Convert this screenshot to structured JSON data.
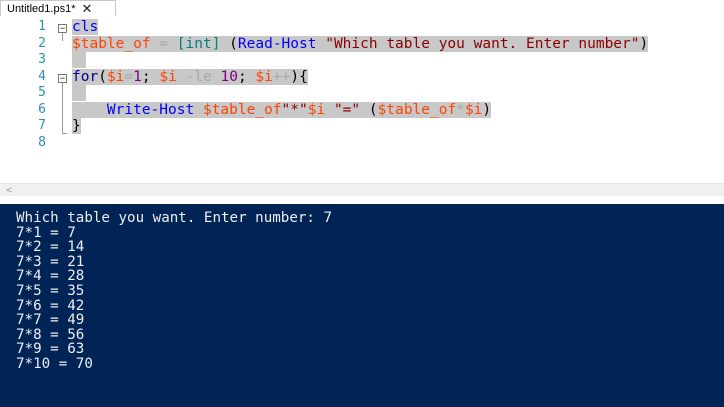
{
  "tab": {
    "title": "Untitled1.ps1*",
    "close_glyph": "✕"
  },
  "editor": {
    "line_numbers": [
      "1",
      "2",
      "3",
      "4",
      "5",
      "6",
      "7",
      "8"
    ],
    "fold_glyph": "−",
    "lines": [
      [
        {
          "t": "cls",
          "c": "t-cmd"
        }
      ],
      [
        {
          "t": "$table_of",
          "c": "t-var"
        },
        {
          "t": " = ",
          "c": "t-op"
        },
        {
          "t": "[int]",
          "c": "t-type"
        },
        {
          "t": " (",
          "c": "t-pl"
        },
        {
          "t": "Read-Host",
          "c": "t-cmd"
        },
        {
          "t": " ",
          "c": "t-pl"
        },
        {
          "t": "\"Which table you want. Enter number\"",
          "c": "t-str"
        },
        {
          "t": ")",
          "c": "t-pl"
        }
      ],
      [],
      [
        {
          "t": "for",
          "c": "t-kw"
        },
        {
          "t": "(",
          "c": "t-pl"
        },
        {
          "t": "$i",
          "c": "t-var"
        },
        {
          "t": "=",
          "c": "t-op"
        },
        {
          "t": "1",
          "c": "t-num"
        },
        {
          "t": "; ",
          "c": "t-pl"
        },
        {
          "t": "$i",
          "c": "t-var"
        },
        {
          "t": " -le ",
          "c": "t-op"
        },
        {
          "t": "10",
          "c": "t-num"
        },
        {
          "t": "; ",
          "c": "t-pl"
        },
        {
          "t": "$i",
          "c": "t-var"
        },
        {
          "t": "++",
          "c": "t-op"
        },
        {
          "t": "){",
          "c": "t-pl"
        }
      ],
      [],
      [
        {
          "t": "    ",
          "c": "t-pl"
        },
        {
          "t": "Write-Host",
          "c": "t-cmd"
        },
        {
          "t": " ",
          "c": "t-pl"
        },
        {
          "t": "$table_of",
          "c": "t-var"
        },
        {
          "t": "\"*\"",
          "c": "t-str"
        },
        {
          "t": "$i",
          "c": "t-var"
        },
        {
          "t": " ",
          "c": "t-pl"
        },
        {
          "t": "\"=\"",
          "c": "t-str"
        },
        {
          "t": " (",
          "c": "t-pl"
        },
        {
          "t": "$table_of",
          "c": "t-var"
        },
        {
          "t": "*",
          "c": "t-op"
        },
        {
          "t": "$i",
          "c": "t-var"
        },
        {
          "t": ")",
          "c": "t-pl"
        }
      ],
      [
        {
          "t": "}",
          "c": "t-pl"
        }
      ],
      []
    ]
  },
  "scrollbar": {
    "left_arrow": "<"
  },
  "console": {
    "lines": [
      "Which table you want. Enter number: 7",
      "7*1 = 7",
      "7*2 = 14",
      "7*3 = 21",
      "7*4 = 28",
      "7*5 = 35",
      "7*6 = 42",
      "7*7 = 49",
      "7*8 = 56",
      "7*9 = 63",
      "7*10 = 70"
    ]
  },
  "colors": {
    "console_bg": "#012456",
    "console_fg": "#eeedf0",
    "selection": "#c8c8c8",
    "line_number": "#2b91af"
  }
}
